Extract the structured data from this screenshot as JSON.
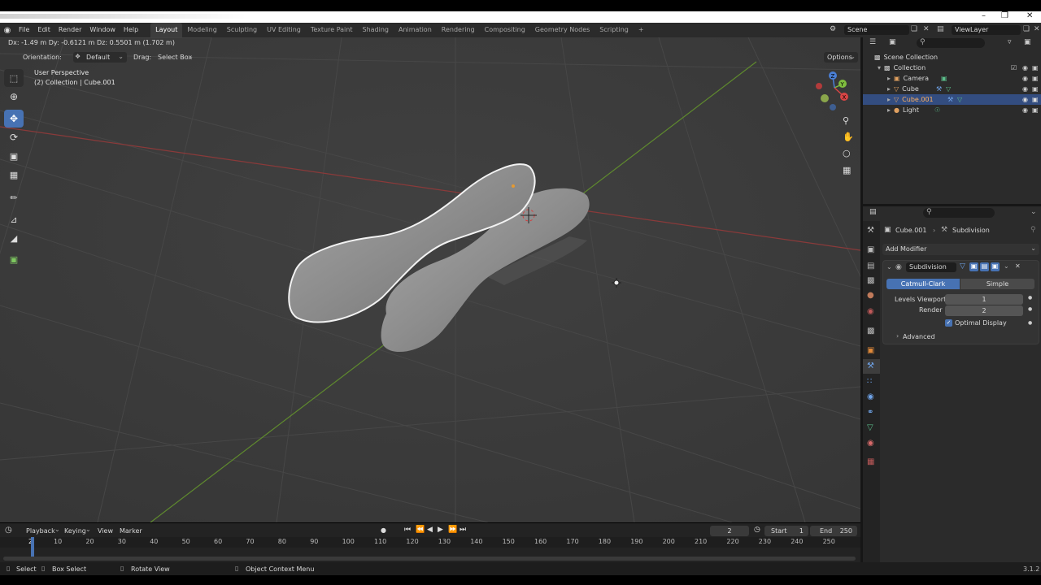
{
  "app": {
    "window_title": "Blender"
  },
  "menubar": {
    "menus": [
      "File",
      "Edit",
      "Render",
      "Window",
      "Help"
    ],
    "workspaces": [
      "Layout",
      "Modeling",
      "Sculpting",
      "UV Editing",
      "Texture Paint",
      "Shading",
      "Animation",
      "Rendering",
      "Compositing",
      "Geometry Nodes",
      "Scripting"
    ],
    "active_workspace": "Layout",
    "add_tab": "+",
    "scene_label": "Scene",
    "viewlayer_label": "ViewLayer"
  },
  "viewport": {
    "transform_readout": "Dx: -1.49 m   Dy: -0.6121 m   Dz: 0.5501 m (1.702 m)",
    "orientation_label": "Orientation:",
    "orientation_value": "Default",
    "drag_label": "Drag:",
    "drag_value": "Select Box",
    "options_label": "Options",
    "perspective_label": "User Perspective",
    "collection_label": "(2) Collection | Cube.001",
    "axis_labels": {
      "x": "X",
      "y": "Y",
      "z": "Z"
    }
  },
  "outliner": {
    "root": "Scene Collection",
    "collection": "Collection",
    "items": [
      {
        "label": "Camera",
        "selected": false,
        "icon": "camera-icon",
        "color": "#e0a060"
      },
      {
        "label": "Cube",
        "selected": false,
        "icon": "mesh-icon",
        "color": "#e0a060"
      },
      {
        "label": "Cube.001",
        "selected": true,
        "icon": "mesh-icon",
        "color": "#e0a060"
      },
      {
        "label": "Light",
        "selected": false,
        "icon": "light-icon",
        "color": "#e0a060"
      }
    ]
  },
  "properties": {
    "breadcrumb_object": "Cube.001",
    "breadcrumb_modifier": "Subdivision",
    "add_modifier_label": "Add Modifier",
    "modifier_name": "Subdivision",
    "mode_catmull": "Catmull-Clark",
    "mode_simple": "Simple",
    "levels_viewport_label": "Levels Viewport",
    "levels_viewport_value": "1",
    "render_label": "Render",
    "render_value": "2",
    "optimal_display_label": "Optimal Display",
    "advanced_label": "Advanced",
    "accent_color": "#4772b3"
  },
  "timeline": {
    "menus": [
      "Playback",
      "Keying",
      "View",
      "Marker"
    ],
    "current_frame": "2",
    "start_label": "Start",
    "start_value": "1",
    "end_label": "End",
    "end_value": "250",
    "ticks": [
      "2",
      "10",
      "20",
      "30",
      "40",
      "50",
      "60",
      "70",
      "80",
      "90",
      "100",
      "110",
      "120",
      "130",
      "140",
      "150",
      "160",
      "170",
      "180",
      "190",
      "200",
      "210",
      "220",
      "230",
      "240",
      "250"
    ]
  },
  "statusbar": {
    "select_label": "Select",
    "box_select_label": "Box Select",
    "rotate_label": "Rotate View",
    "context_label": "Object Context Menu",
    "version": "3.1.2"
  }
}
